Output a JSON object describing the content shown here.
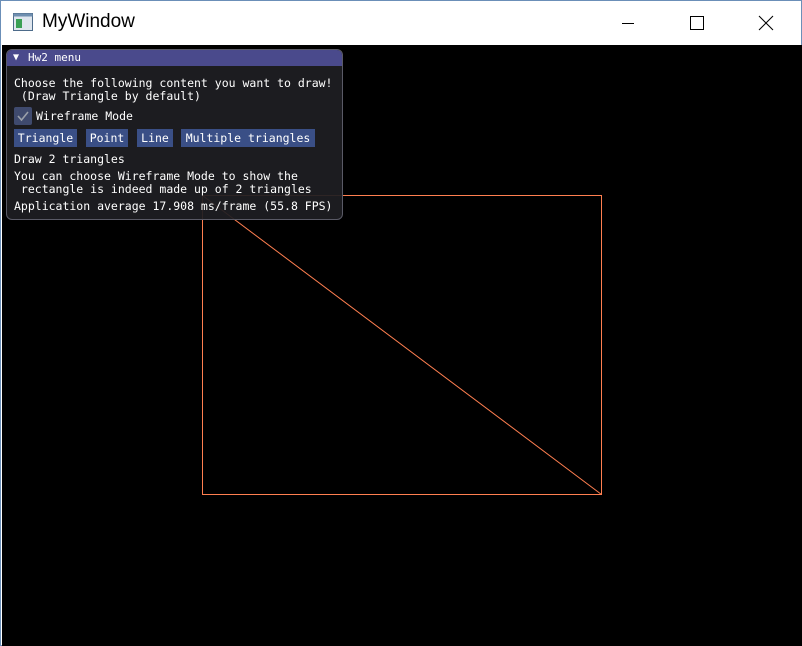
{
  "window": {
    "title": "MyWindow"
  },
  "colors": {
    "canvas_bg": "#000000",
    "wireframe": "#ff7f50",
    "imgui_title_bg": "#4a4a8c",
    "imgui_button_bg": "#3a4f86"
  },
  "menu": {
    "title": "Hw2 menu",
    "instructions_line1": "Choose the following content you want to draw!",
    "instructions_line2": " (Draw Triangle by default)",
    "wireframe_label": "Wireframe Mode",
    "wireframe_checked": true,
    "buttons": {
      "triangle": "Triangle",
      "point": "Point",
      "line": "Line",
      "multiple": "Multiple triangles"
    },
    "status": "Draw 2 triangles",
    "hint_line1": "You can choose Wireframe Mode to show the",
    "hint_line2": " rectangle is indeed made up of 2 triangles",
    "fps": "Application average 17.908 ms/frame (55.8 FPS)"
  }
}
